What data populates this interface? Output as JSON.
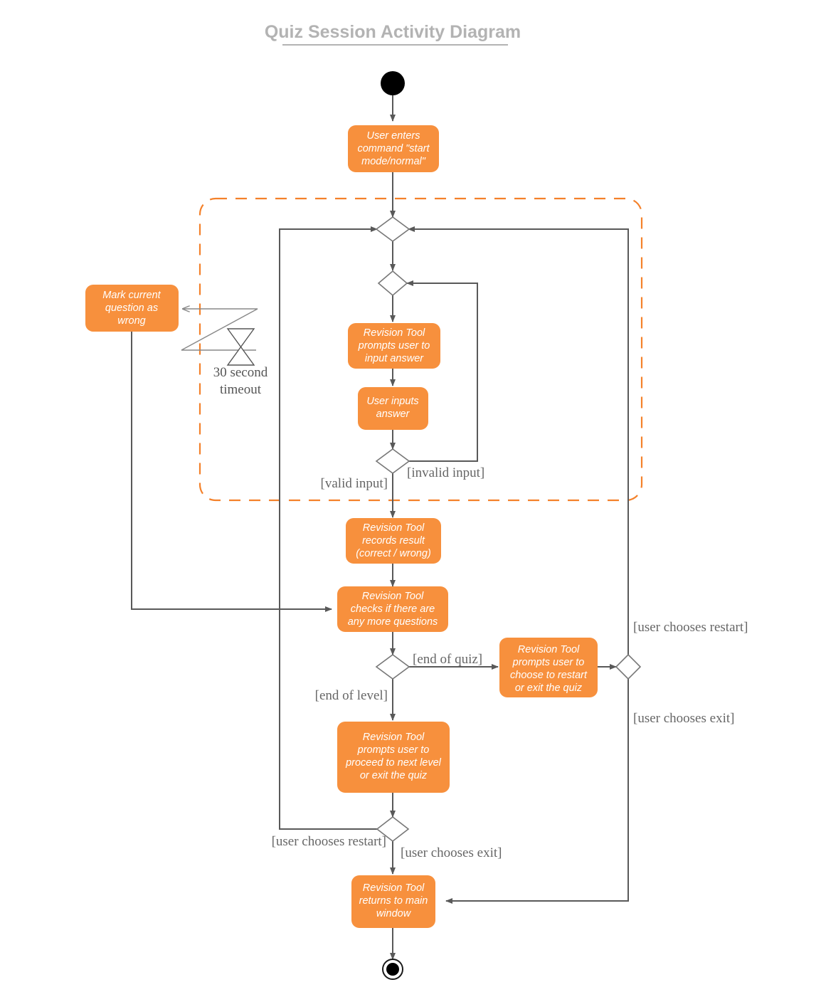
{
  "diagram": {
    "title": "Quiz Session Activity Diagram",
    "type": "UML Activity Diagram",
    "colors": {
      "node_fill": "#f7903d",
      "node_text": "#ffffff",
      "flow": "#595959",
      "region_border": "#f4812a",
      "title": "#b3b3b3",
      "guard_text": "#666666"
    },
    "nodes": {
      "start": {
        "name": "initial-node"
      },
      "enter_command": {
        "lines": [
          "User enters",
          "command \"start",
          "mode/normal\""
        ]
      },
      "mark_wrong": {
        "lines": [
          "Mark current",
          "question as",
          "wrong"
        ]
      },
      "prompt_answer": {
        "lines": [
          "Revision Tool",
          "prompts user to",
          "input answer"
        ]
      },
      "user_inputs": {
        "lines": [
          "User inputs",
          "answer"
        ]
      },
      "records_result": {
        "lines": [
          "Revision Tool",
          "records result",
          "(correct / wrong)"
        ]
      },
      "checks_questions": {
        "lines": [
          "Revision Tool",
          "checks if there are",
          "any more questions"
        ]
      },
      "prompt_restart_exit": {
        "lines": [
          "Revision Tool",
          "prompts user to",
          "choose to restart",
          "or exit the quiz"
        ]
      },
      "prompt_next_level": {
        "lines": [
          "Revision Tool",
          "prompts user to",
          "proceed to next level",
          "or exit the quiz"
        ]
      },
      "returns_main": {
        "lines": [
          "Revision Tool",
          "returns to main",
          "window"
        ]
      },
      "final": {
        "name": "final-node"
      }
    },
    "guards": {
      "valid_input": "[valid input]",
      "invalid_input": "[invalid input]",
      "end_of_quiz": "[end of quiz]",
      "end_of_level": "[end of level]",
      "user_restart_right": "[user chooses restart]",
      "user_exit_right": "[user chooses exit]",
      "user_restart_bottom": "[user chooses restart]",
      "user_exit_bottom": "[user chooses exit]"
    },
    "timeout": {
      "line1": "30 second",
      "line2": "timeout"
    }
  }
}
